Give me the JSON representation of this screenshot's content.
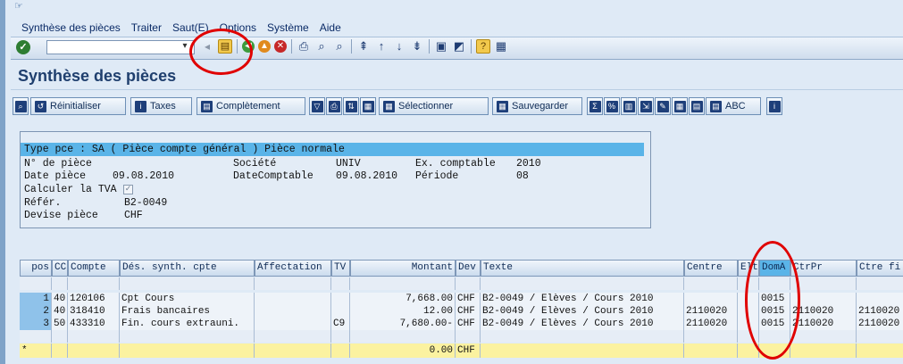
{
  "menu": [
    "Synthèse des pièces",
    "Traiter",
    "Saut(E)",
    "Options",
    "Système",
    "Aide"
  ],
  "menu_handle": "☞",
  "command_field": "",
  "page_title": "Synthèse des pièces",
  "app_toolbar": {
    "reset": "Réinitialiser",
    "taxes": "Taxes",
    "completion": "Complètement",
    "select": "Sélectionner",
    "save": "Sauvegarder",
    "abc": "ABC"
  },
  "header": {
    "doc_type": "Type pce : SA ( Pièce compte général ) Pièce normale",
    "doc_no_label": "N° de pièce",
    "company_label": "Société",
    "company": "UNIV",
    "fiscal_year_label": "Ex. comptable",
    "fiscal_year": "2010",
    "doc_date_label": "Date pièce",
    "doc_date": "09.08.2010",
    "posting_date_label": "DateComptable",
    "posting_date": "09.08.2010",
    "period_label": "Période",
    "period": "08",
    "calc_tax_label": "Calculer la TVA",
    "calc_tax_checked": true,
    "reference_label": "Référ.",
    "reference": "B2-0049",
    "currency_label": "Devise pièce",
    "currency": "CHF"
  },
  "table": {
    "columns": [
      "pos",
      "CC",
      "Compte",
      "Dés. synth. cpte",
      "Affectation",
      "TV",
      "Montant",
      "Dev",
      "Texte",
      "Centre",
      "Elt",
      "DomA",
      "CtrPr",
      "Ctre fi"
    ],
    "rows": [
      [
        "1",
        "40",
        "120106",
        "Cpt Cours",
        "",
        "",
        "7,668.00",
        "CHF",
        "B2-0049 / Elèves / Cours 2010",
        "",
        "",
        "0015",
        "",
        ""
      ],
      [
        "2",
        "40",
        "318410",
        "Frais bancaires",
        "",
        "",
        "12.00",
        "CHF",
        "B2-0049 / Elèves / Cours 2010",
        "2110020",
        "",
        "0015",
        "2110020",
        "2110020"
      ],
      [
        "3",
        "50",
        "433310",
        "Fin. cours extrauni.",
        "",
        "C9",
        "7,680.00-",
        "CHF",
        "B2-0049 / Elèves / Cours 2010",
        "2110020",
        "",
        "0015",
        "2110020",
        "2110020"
      ]
    ],
    "total_marker": "*",
    "total_amount": "0.00",
    "total_currency": "CHF"
  }
}
